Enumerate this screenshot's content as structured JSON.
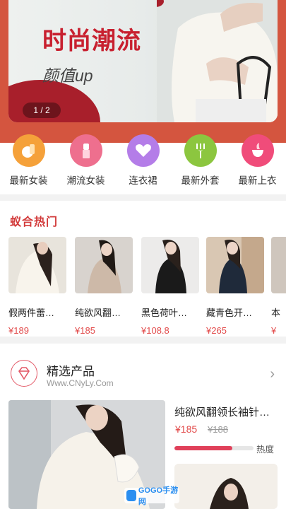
{
  "banner": {
    "title": "时尚潮流",
    "subtitle": "颜值up",
    "page_indicator": "1 / 2"
  },
  "categories": [
    {
      "label": "最新女装",
      "icon": "bag-icon",
      "color": "#f5a13a"
    },
    {
      "label": "潮流女装",
      "icon": "lipstick-icon",
      "color": "#ee6f8e"
    },
    {
      "label": "连衣裙",
      "icon": "heart-icon",
      "color": "#b47de8"
    },
    {
      "label": "最新外套",
      "icon": "fork-icon",
      "color": "#8cc63f"
    },
    {
      "label": "最新上衣",
      "icon": "cup-icon",
      "color": "#f04c7a"
    }
  ],
  "hot": {
    "title": "蚁合热门",
    "items": [
      {
        "name": "假两件蕾…",
        "price": "¥189"
      },
      {
        "name": "纯欲风翻…",
        "price": "¥185"
      },
      {
        "name": "黑色荷叶…",
        "price": "¥108.8"
      },
      {
        "name": "藏青色开…",
        "price": "¥265"
      },
      {
        "name": "本",
        "price": "¥"
      }
    ]
  },
  "featured": {
    "title": "精选产品",
    "url": "Www.CNyLy.Com",
    "product": {
      "name": "纯欲风翻领长袖针…",
      "price": "¥185",
      "old_price": "¥188",
      "heat_label": "热度",
      "heat_fraction": 0.73
    }
  },
  "watermark": "GOGO手游网"
}
